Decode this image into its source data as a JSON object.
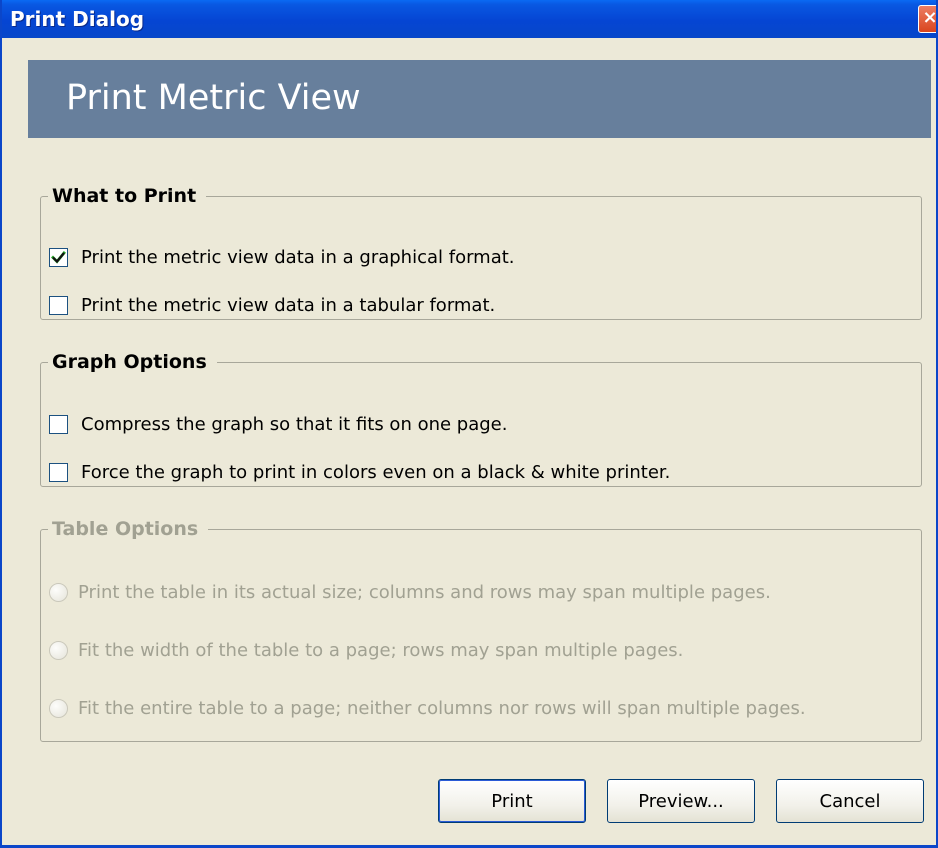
{
  "window": {
    "title": "Print Dialog",
    "close_label": "×"
  },
  "banner": {
    "heading": "Print Metric View"
  },
  "what_to_print": {
    "legend": "What to Print",
    "options": [
      {
        "label": "Print the metric view data in a graphical format.",
        "checked": true
      },
      {
        "label": "Print the metric view data in a tabular format.",
        "checked": false
      }
    ]
  },
  "graph_options": {
    "legend": "Graph Options",
    "options": [
      {
        "label": "Compress the graph so that it fits on one page.",
        "checked": false
      },
      {
        "label": "Force the graph to print in colors even on a black & white printer.",
        "checked": false
      }
    ]
  },
  "table_options": {
    "legend": "Table Options",
    "enabled": false,
    "options": [
      {
        "label": "Print the table in its actual size; columns and rows may span multiple pages.",
        "selected": false
      },
      {
        "label": "Fit the width of the table to a page; rows may span multiple pages.",
        "selected": false
      },
      {
        "label": "Fit the entire table to a page; neither columns nor rows will span multiple pages.",
        "selected": false
      }
    ]
  },
  "buttons": {
    "print": "Print",
    "preview": "Preview...",
    "cancel": "Cancel"
  }
}
